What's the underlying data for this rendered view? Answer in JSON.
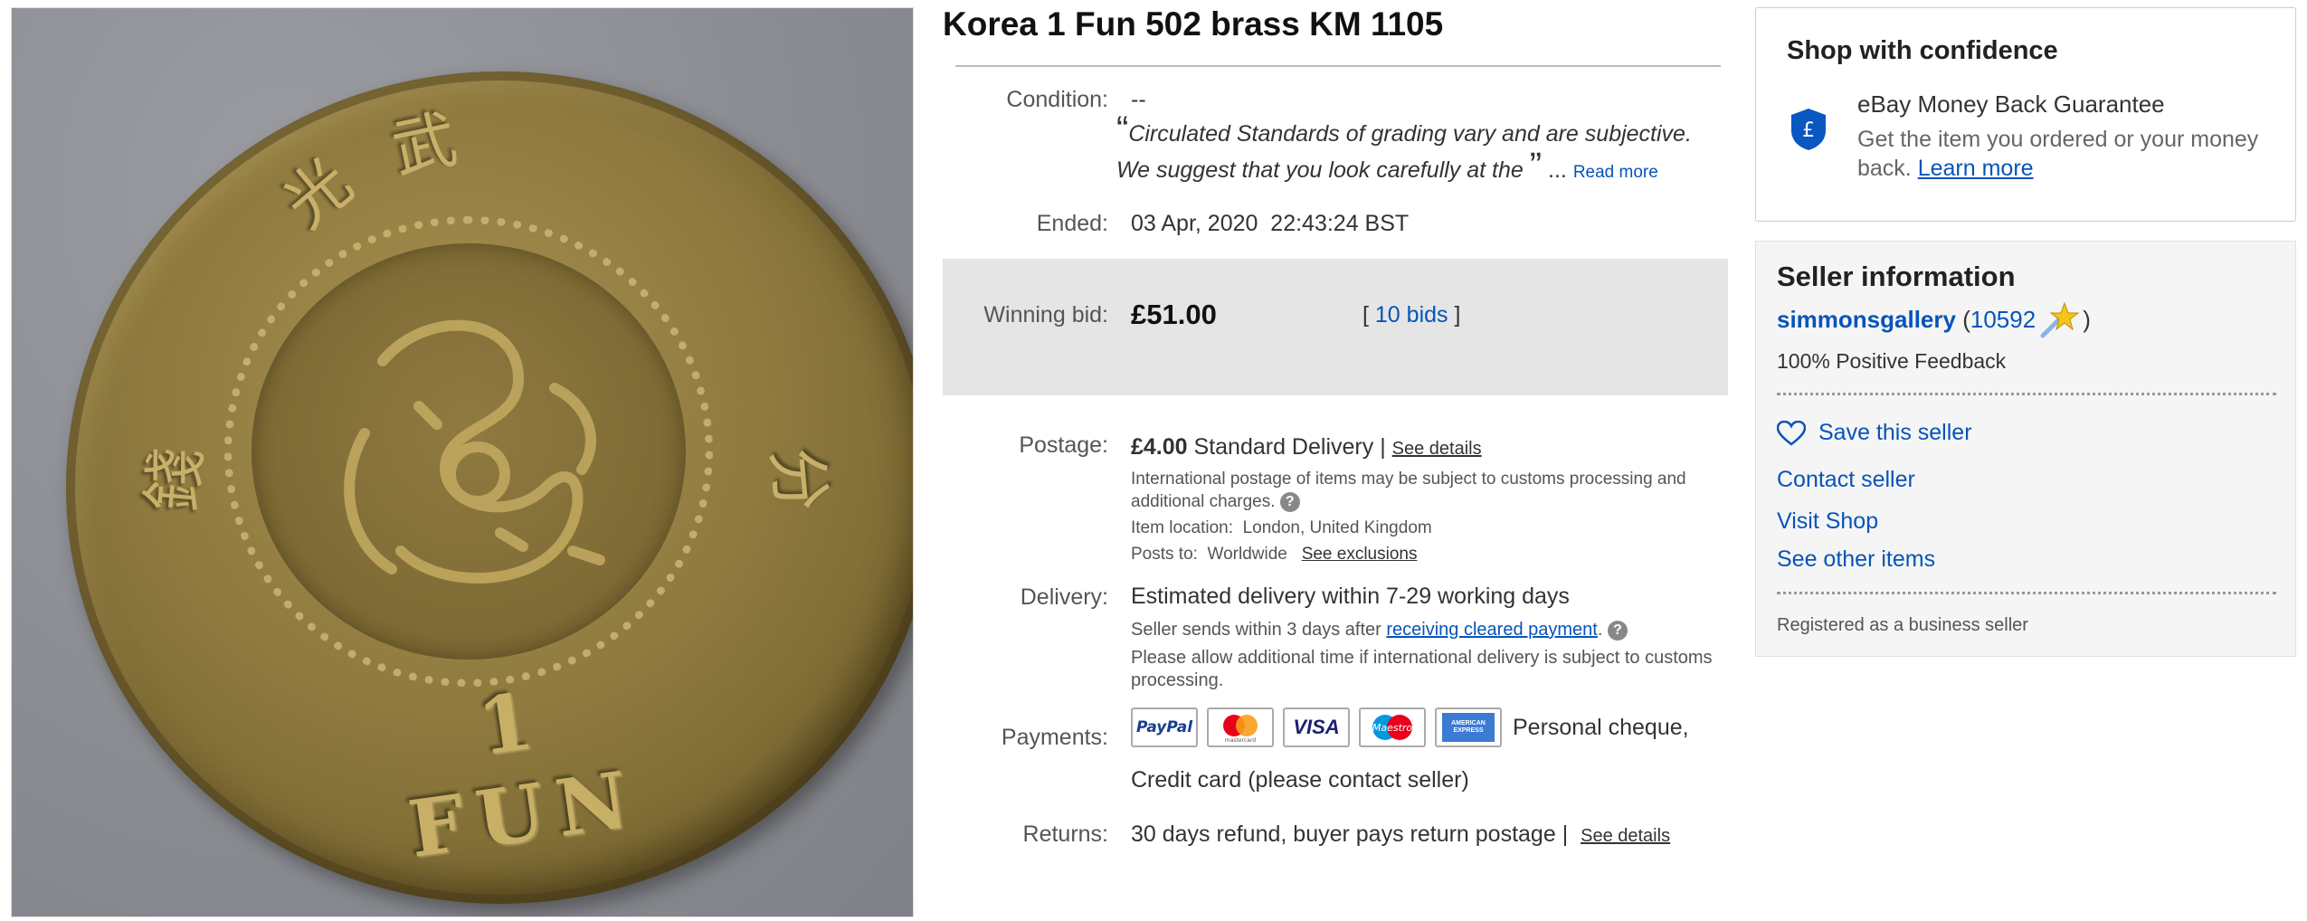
{
  "item": {
    "title": "Korea 1 Fun 502 brass KM 1105",
    "coin_inscription": "1 FUN"
  },
  "condition": {
    "label": "Condition:",
    "value": "--",
    "quote_open": "“",
    "quote_text": "Circulated Standards of grading vary and are subjective. We suggest that you look carefully at the",
    "quote_close": "”",
    "ellipsis": "...",
    "read_more": "Read more"
  },
  "ended": {
    "label": "Ended:",
    "value": "03 Apr, 2020  22:43:24 BST"
  },
  "bid": {
    "label": "Winning bid:",
    "amount": "£51.00",
    "bracket_open": "[",
    "bids_link": "10 bids",
    "bracket_close": "]"
  },
  "postage": {
    "label": "Postage:",
    "price": "£4.00",
    "method": "Standard Delivery",
    "sep": "|",
    "see_details": "See details",
    "intl_note": "International postage of items may be subject to customs processing and additional charges.",
    "help": "?",
    "location_label": "Item location:",
    "location": "London, United Kingdom",
    "posts_to_label": "Posts to:",
    "posts_to": "Worldwide",
    "see_exclusions": "See exclusions"
  },
  "delivery": {
    "label": "Delivery:",
    "estimate": "Estimated delivery within 7-29 working days",
    "sends_prefix": "Seller sends within 3 days after",
    "sends_link": "receiving cleared payment",
    "sends_suffix": ".",
    "help": "?",
    "note": "Please allow additional time if international delivery is subject to customs processing."
  },
  "payments": {
    "label": "Payments:",
    "cards": [
      "PayPal",
      "mastercard",
      "VISA",
      "Maestro",
      "AMERICAN EXPRESS"
    ],
    "text1": "Personal cheque,",
    "text2": "Credit card (please contact seller)"
  },
  "returns": {
    "label": "Returns:",
    "value": "30 days refund, buyer pays return postage",
    "sep": "|",
    "see_details": "See details"
  },
  "confidence": {
    "title": "Shop with confidence",
    "mbg_title": "eBay Money Back Guarantee",
    "mbg_desc": "Get the item you ordered or your money back.",
    "learn_more": "Learn more"
  },
  "seller": {
    "title": "Seller information",
    "name": "simmonsgallery",
    "paren_open": "(",
    "feedback_count": "10592",
    "paren_close": ")",
    "positive": "100% Positive Feedback",
    "save": "Save this seller",
    "contact": "Contact seller",
    "visit_shop": "Visit Shop",
    "other_items": "See other items",
    "registered": "Registered as a business seller"
  },
  "colors": {
    "link": "#0654ba",
    "bid_box": "#e5e5e5",
    "seller_box": "#f5f5f5",
    "shield": "#0a57c2"
  }
}
